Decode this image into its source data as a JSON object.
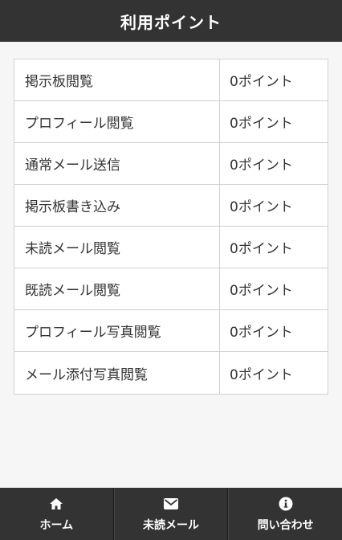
{
  "header": {
    "title": "利用ポイント"
  },
  "points": [
    {
      "name": "掲示板閲覧",
      "value": "0ポイント"
    },
    {
      "name": "プロフィール閲覧",
      "value": "0ポイント"
    },
    {
      "name": "通常メール送信",
      "value": "0ポイント"
    },
    {
      "name": "掲示板書き込み",
      "value": "0ポイント"
    },
    {
      "name": "未読メール閲覧",
      "value": "0ポイント"
    },
    {
      "name": "既読メール閲覧",
      "value": "0ポイント"
    },
    {
      "name": "プロフィール写真閲覧",
      "value": "0ポイント"
    },
    {
      "name": "メール添付写真閲覧",
      "value": "0ポイント"
    }
  ],
  "footer": {
    "items": [
      {
        "label": "ホーム",
        "icon": "home-icon"
      },
      {
        "label": "未読メール",
        "icon": "mail-icon"
      },
      {
        "label": "問い合わせ",
        "icon": "info-icon"
      }
    ]
  },
  "colors": {
    "bar": "#333333",
    "background": "#f6f6f6",
    "border": "#d0d0d0"
  }
}
